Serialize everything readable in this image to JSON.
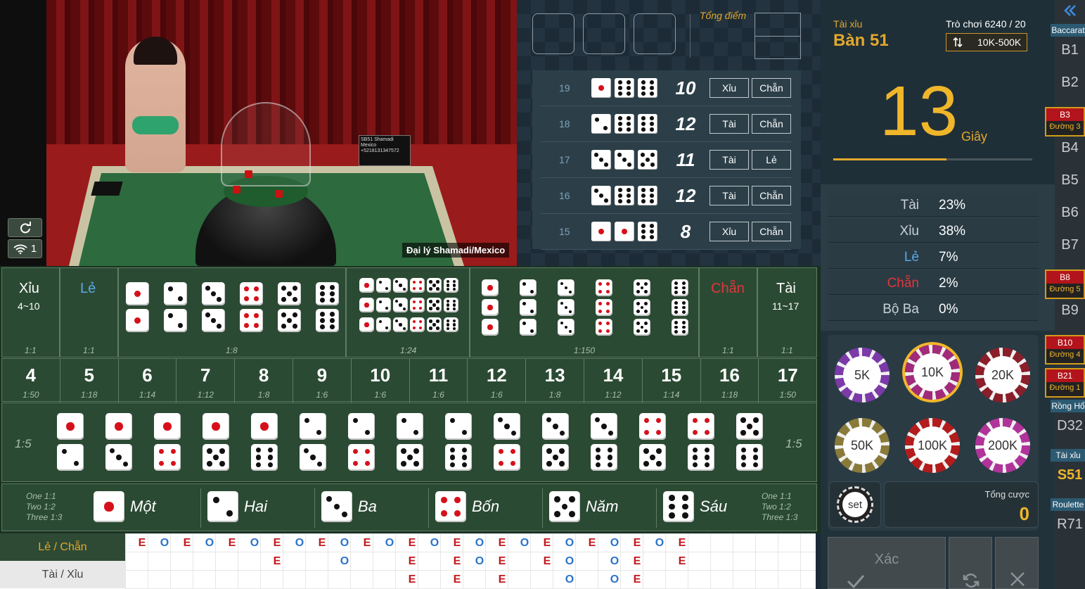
{
  "video": {
    "dealer_label": "Đại lý Shamadi/Mexico",
    "sign_text": "SB51 Shamadi Mexico +5218131347572",
    "refresh_icon": "refresh-icon",
    "wifi_icon": "wifi-icon",
    "connection_count": "1"
  },
  "results": {
    "total_label": "Tổng điểm",
    "rows": [
      {
        "round": "19",
        "dice": [
          1,
          6,
          6
        ],
        "total": "10",
        "big_small": "Xỉu",
        "odd_even": "Chẵn"
      },
      {
        "round": "18",
        "dice": [
          2,
          6,
          6
        ],
        "total": "12",
        "big_small": "Tài",
        "odd_even": "Chẵn"
      },
      {
        "round": "17",
        "dice": [
          3,
          3,
          5
        ],
        "total": "11",
        "big_small": "Tài",
        "odd_even": "Lẻ"
      },
      {
        "round": "16",
        "dice": [
          3,
          6,
          6
        ],
        "total": "12",
        "big_small": "Tài",
        "odd_even": "Chẵn"
      },
      {
        "round": "15",
        "dice": [
          1,
          1,
          6
        ],
        "total": "8",
        "big_small": "Xỉu",
        "odd_even": "Chẵn"
      }
    ]
  },
  "board": {
    "xiu": {
      "label": "Xỉu",
      "range": "4~10",
      "odds": "1:1"
    },
    "le": {
      "label": "Lẻ",
      "odds": "1:1"
    },
    "chan": {
      "label": "Chẵn",
      "odds": "1:1"
    },
    "tai": {
      "label": "Tài",
      "range": "11~17",
      "odds": "1:1"
    },
    "pair_odds": "1:8",
    "any_triple_odds": "1:24",
    "triple_odds": "1:150",
    "sums": [
      {
        "n": "4",
        "o": "1:50"
      },
      {
        "n": "5",
        "o": "1:18"
      },
      {
        "n": "6",
        "o": "1:14"
      },
      {
        "n": "7",
        "o": "1:12"
      },
      {
        "n": "8",
        "o": "1:8"
      },
      {
        "n": "9",
        "o": "1:6"
      },
      {
        "n": "10",
        "o": "1:6"
      },
      {
        "n": "11",
        "o": "1:6"
      },
      {
        "n": "12",
        "o": "1:6"
      },
      {
        "n": "13",
        "o": "1:8"
      },
      {
        "n": "14",
        "o": "1:12"
      },
      {
        "n": "15",
        "o": "1:14"
      },
      {
        "n": "16",
        "o": "1:18"
      },
      {
        "n": "17",
        "o": "1:50"
      }
    ],
    "combo_odds_left": "1:5",
    "combo_odds_right": "1:5",
    "combos": [
      [
        1,
        2
      ],
      [
        1,
        3
      ],
      [
        1,
        4
      ],
      [
        1,
        5
      ],
      [
        1,
        6
      ],
      [
        2,
        3
      ],
      [
        2,
        4
      ],
      [
        2,
        5
      ],
      [
        2,
        6
      ],
      [
        3,
        4
      ],
      [
        3,
        5
      ],
      [
        3,
        6
      ],
      [
        4,
        5
      ],
      [
        4,
        6
      ],
      [
        5,
        6
      ]
    ],
    "single_odds": [
      "One 1:1",
      "Two 1:2",
      "Three 1:3"
    ],
    "singles": [
      "Một",
      "Hai",
      "Ba",
      "Bốn",
      "Năm",
      "Sáu"
    ]
  },
  "road": {
    "tab_odd_even": "Lẻ / Chẵn",
    "tab_big_small": "Tài / Xỉu",
    "row1": [
      "E",
      "O",
      "E",
      "O",
      "E",
      "O",
      "E",
      "O",
      "E",
      "O",
      "E",
      "O",
      "E",
      "O",
      "E",
      "O",
      "E",
      "O",
      "E",
      "O",
      "E",
      "O",
      "E",
      "O",
      "E"
    ],
    "row2": [
      "",
      "",
      "",
      "",
      "",
      "",
      "E",
      "",
      "",
      "O",
      "",
      "",
      "E",
      "",
      "E",
      "O",
      "E",
      "",
      "E",
      "O",
      "",
      "O",
      "E",
      "",
      "E"
    ],
    "row3": [
      "",
      "",
      "",
      "",
      "",
      "",
      "",
      "",
      "",
      "",
      "",
      "",
      "E",
      "",
      "E",
      "",
      "E",
      "",
      "",
      "O",
      "",
      "O",
      "E",
      "",
      ""
    ]
  },
  "table_info": {
    "game": "Tài xỉu",
    "table_name": "Bàn 51",
    "round_info": "Trò chơi 6240 / 20",
    "limits": "10K-500K",
    "sort_icon": "sort-arrows-icon",
    "countdown": "13",
    "countdown_unit": "Giây",
    "countdown_progress": 0.57
  },
  "stats": [
    {
      "name": "Tài",
      "value": "23%",
      "color": "#c9d1d6"
    },
    {
      "name": "Xỉu",
      "value": "38%",
      "color": "#c9d1d6"
    },
    {
      "name": "Lẻ",
      "value": "7%",
      "color": "#5aa7e8"
    },
    {
      "name": "Chẵn",
      "value": "2%",
      "color": "#e2353b"
    },
    {
      "name": "Bộ Ba",
      "value": "0%",
      "color": "#c9d1d6"
    }
  ],
  "chips": [
    {
      "label": "5K",
      "color": "#7b3aa8"
    },
    {
      "label": "10K",
      "color": "#a12a7a"
    },
    {
      "label": "20K",
      "color": "#8a1e2a"
    },
    {
      "label": "50K",
      "color": "#8a7a3a"
    },
    {
      "label": "100K",
      "color": "#b31c1c"
    },
    {
      "label": "200K",
      "color": "#b0339a"
    }
  ],
  "set_label": "set",
  "total_bet_label": "Tổng cược",
  "total_bet_value": "0",
  "confirm_label": "Xác",
  "nav": {
    "collapse_icon": "double-chevron-left-icon",
    "items": [
      {
        "type": "header",
        "label": "Baccarat"
      },
      {
        "type": "item",
        "label": "B1"
      },
      {
        "type": "item",
        "label": "B2"
      },
      {
        "type": "active",
        "label": "B3",
        "sub": "Đường 3"
      },
      {
        "type": "item",
        "label": "B4"
      },
      {
        "type": "item",
        "label": "B5"
      },
      {
        "type": "item",
        "label": "B6"
      },
      {
        "type": "item",
        "label": "B7"
      },
      {
        "type": "active",
        "label": "B8",
        "sub": "Đường 5"
      },
      {
        "type": "item",
        "label": "B9"
      },
      {
        "type": "active",
        "label": "B10",
        "sub": "Đường 4"
      },
      {
        "type": "active",
        "label": "B21",
        "sub": "Đường 1"
      },
      {
        "type": "header",
        "label": "Rồng Hổ"
      },
      {
        "type": "item",
        "label": "D32"
      },
      {
        "type": "header",
        "label": "Tài xỉu"
      },
      {
        "type": "current",
        "label": "S51"
      },
      {
        "type": "header",
        "label": "Roulette"
      },
      {
        "type": "item",
        "label": "R71"
      }
    ]
  }
}
